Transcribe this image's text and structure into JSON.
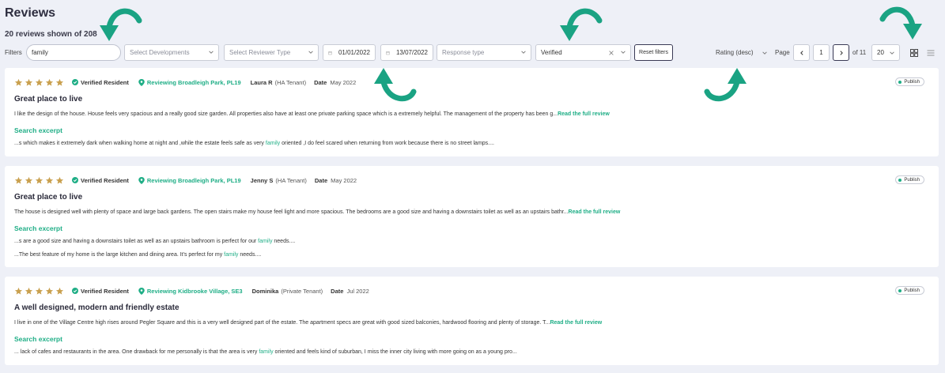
{
  "header": {
    "title": "Reviews",
    "count_text": "20 reviews shown of 208"
  },
  "filters": {
    "label": "Filters",
    "search_value": "family",
    "developments_placeholder": "Select Developments",
    "reviewer_type_placeholder": "Select Reviewer Type",
    "date_from": "01/01/2022",
    "date_to": "13/07/2022",
    "response_type_placeholder": "Response type",
    "verification_value": "Verified",
    "reset_label": "Reset filters"
  },
  "sort": {
    "value": "Rating (desc)"
  },
  "pagination": {
    "page_label": "Page",
    "current_page": "1",
    "of_text": "of 11",
    "per_page": "20"
  },
  "colors": {
    "accent": "#1fae86",
    "star": "#c9a04e",
    "arrow": "#1aa383"
  },
  "reviews": [
    {
      "rating": 5,
      "verified_label": "Verified Resident",
      "location": "Reviewing Broadleigh Park, PL19",
      "reviewer": "Laura R",
      "tenant": "(HA Tenant)",
      "date_label": "Date",
      "date": "May 2022",
      "publish_label": "Publish",
      "title": "Great place to live",
      "body": "I like the design of the house. House feels very spacious and a really good size garden. All properties also have at least one private parking space which is a extremely helpful. The management of the property has been g...",
      "read_more": "Read the full review",
      "excerpt_title": "Search excerpt",
      "excerpts": [
        {
          "pre": "...s which makes it extremely dark when walking home at night and ,while the estate feels safe as very ",
          "match": "family",
          "post": " oriented ,I do feel scared when returning from work because there is no street lamps...."
        }
      ]
    },
    {
      "rating": 5,
      "verified_label": "Verified Resident",
      "location": "Reviewing Broadleigh Park, PL19",
      "reviewer": "Jenny S",
      "tenant": "(HA Tenant)",
      "date_label": "Date",
      "date": "May 2022",
      "publish_label": "Publish",
      "title": "Great place to live",
      "body": "The house is designed well with plenty of space and large back gardens. The open stairs make my house feel light and more spacious. The bedrooms are a good size and having a downstairs toilet as well as an upstairs bathr...",
      "read_more": "Read the full review",
      "excerpt_title": "Search excerpt",
      "excerpts": [
        {
          "pre": "...s are a good size and having a downstairs toilet as well as an upstairs bathroom is perfect for our ",
          "match": "family",
          "post": " needs...."
        },
        {
          "pre": "...The best feature of my home is the large kitchen and dining area. It's perfect for my ",
          "match": "family",
          "post": " needs...."
        }
      ]
    },
    {
      "rating": 5,
      "verified_label": "Verified Resident",
      "location": "Reviewing Kidbrooke Village, SE3",
      "reviewer": "Dominika",
      "tenant": "(Private Tenant)",
      "date_label": "Date",
      "date": "Jul 2022",
      "publish_label": "Publish",
      "title": "A well designed, modern and friendly estate",
      "body": "I live in one of the Village Centre high rises around Pegler Square and this is a very well designed part of the estate. The apartment specs are great with good sized balconies, hardwood flooring and plenty of storage. T...",
      "read_more": "Read the full review",
      "excerpt_title": "Search excerpt",
      "excerpts": [
        {
          "pre": "... lack of cafes and restaurants in the area. One drawback for me personally is that the area is very ",
          "match": "family",
          "post": " oriented and feels kind of suburban, I miss the inner city living with more going on as a young pro..."
        }
      ]
    }
  ]
}
